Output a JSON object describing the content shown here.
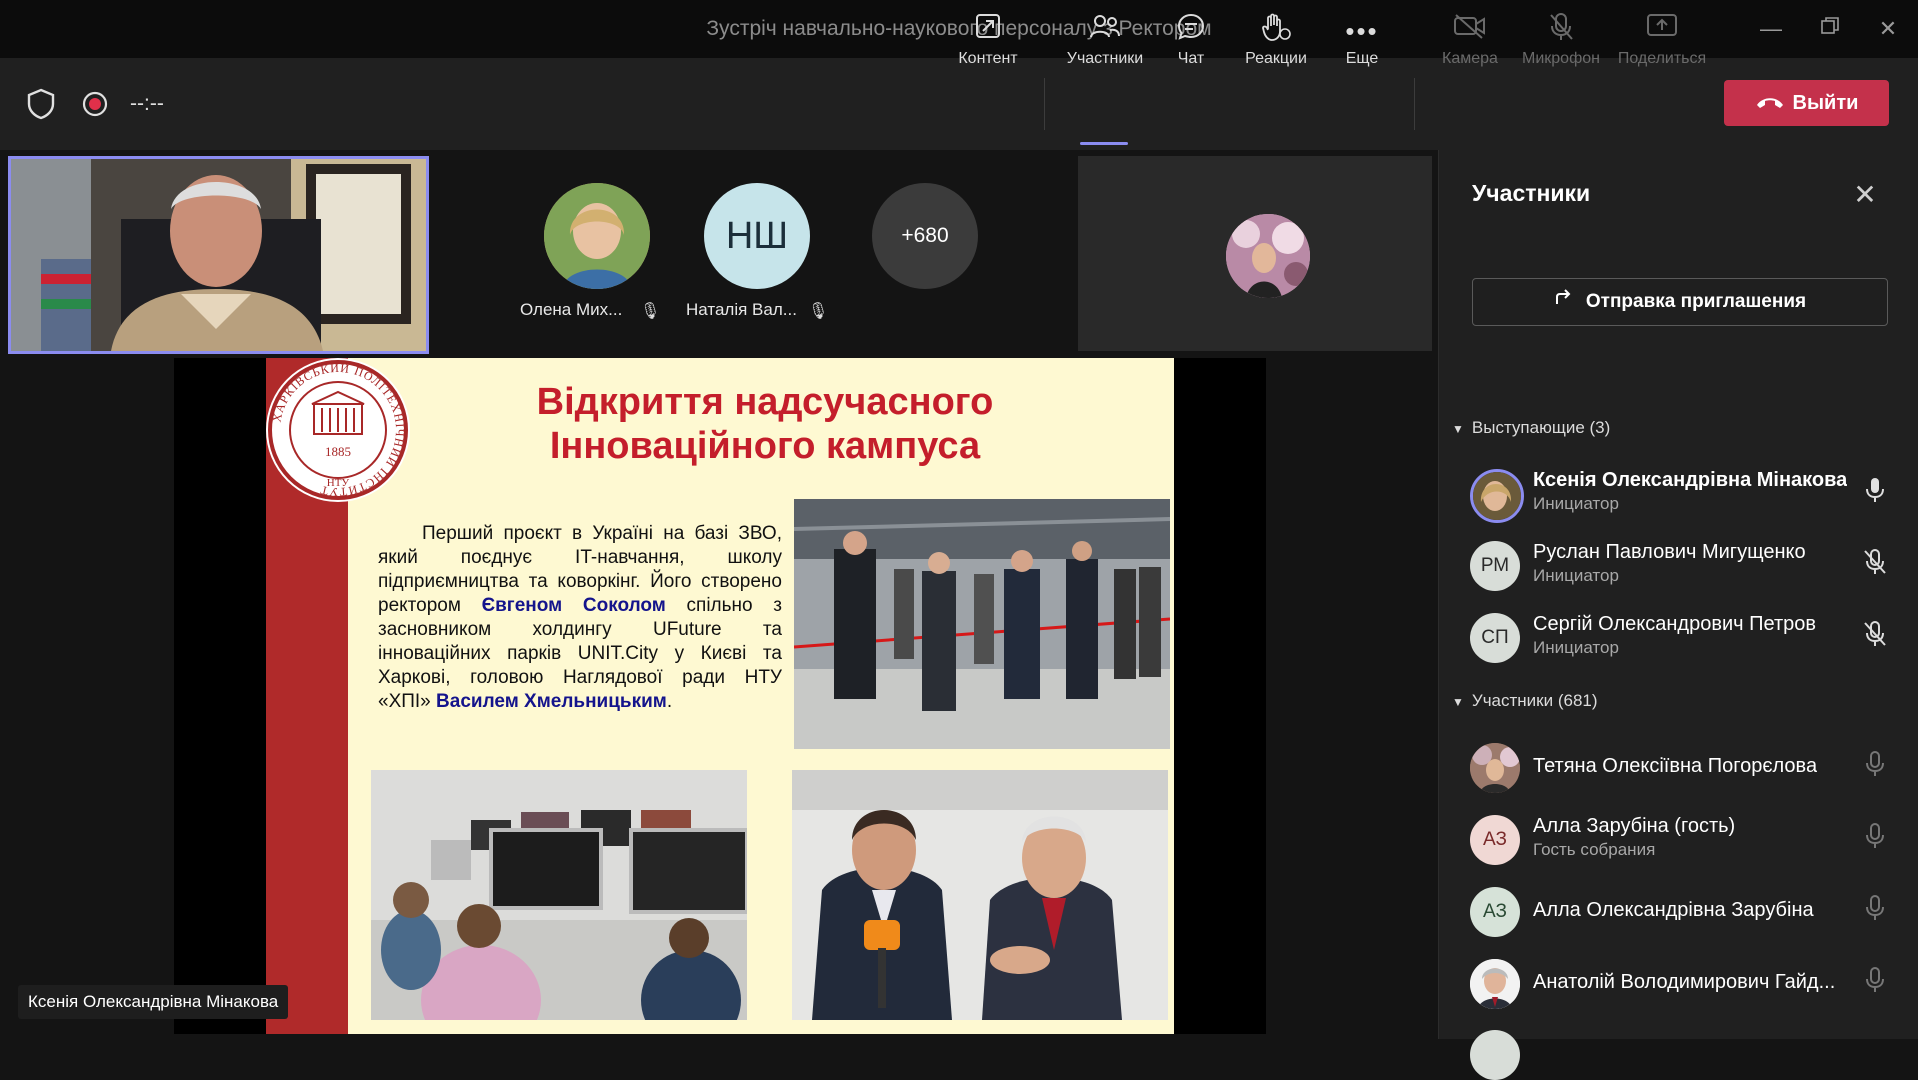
{
  "window": {
    "title": "Зустріч навчально-наукового персоналу з Ректором"
  },
  "toolbar": {
    "timer": "--:--",
    "content_label": "Контент",
    "participants_label": "Участники",
    "chat_label": "Чат",
    "reactions_label": "Реакции",
    "more_label": "Еще",
    "camera_label": "Камера",
    "mic_label": "Микрофон",
    "share_label": "Поделиться",
    "leave_label": "Выйти"
  },
  "stage": {
    "tiles": [
      {
        "name": "Олена Мих..."
      },
      {
        "name": "Наталія Вал...",
        "initials": "НШ"
      }
    ],
    "overflow_count": "+680",
    "active_speaker_name": "Ксенія Олександрівна Мінакова"
  },
  "slide": {
    "logo_year": "1885",
    "logo_ring_text": "ХАРКІВСЬКИЙ ПОЛІТЕХНІЧНИЙ ІНСТИТУТ",
    "logo_bottom": "НТУ",
    "title_line1": "Відкриття надсучасного",
    "title_line2": "Інноваційного кампуса",
    "text_part1": "Перший проєкт в Україні на базі ЗВО, який поєднує IT-навчання, школу підприємництва та коворкінг. Його створено ректором ",
    "text_name1": "Євгеном Соколом",
    "text_part2": " спільно з засновником холдингу UFuture та інноваційних парків UNIT.City у Києві та Харкові, головою Наглядової ради НТУ «ХПІ» ",
    "text_name2": "Василем Хмельницьким",
    "text_part3": "."
  },
  "panel": {
    "title": "Участники",
    "invite_label": "Отправка приглашения",
    "presenters_header": "Выступающие (3)",
    "attendees_header": "Участники (681)",
    "presenters": [
      {
        "name": "Ксенія Олександрівна Мінакова",
        "role": "Инициатор"
      },
      {
        "name": "Руслан Павлович Мигущенко",
        "role": "Инициатор",
        "initials": "РМ"
      },
      {
        "name": "Сергій Олександрович Петров",
        "role": "Инициатор",
        "initials": "СП"
      }
    ],
    "attendees": [
      {
        "name": "Тетяна Олексіївна Погорєлова"
      },
      {
        "name": "Алла Зарубіна (гость)",
        "role": "Гость собрания",
        "initials": "АЗ"
      },
      {
        "name": "Алла Олександрівна Зарубіна",
        "initials": "АЗ"
      },
      {
        "name": "Анатолій Володимирович Гайд..."
      }
    ]
  },
  "colors": {
    "accent": "#8b8cf0",
    "leave": "#c4314b",
    "slide_red": "#c41e2b",
    "slide_bg": "#fef9d2"
  }
}
